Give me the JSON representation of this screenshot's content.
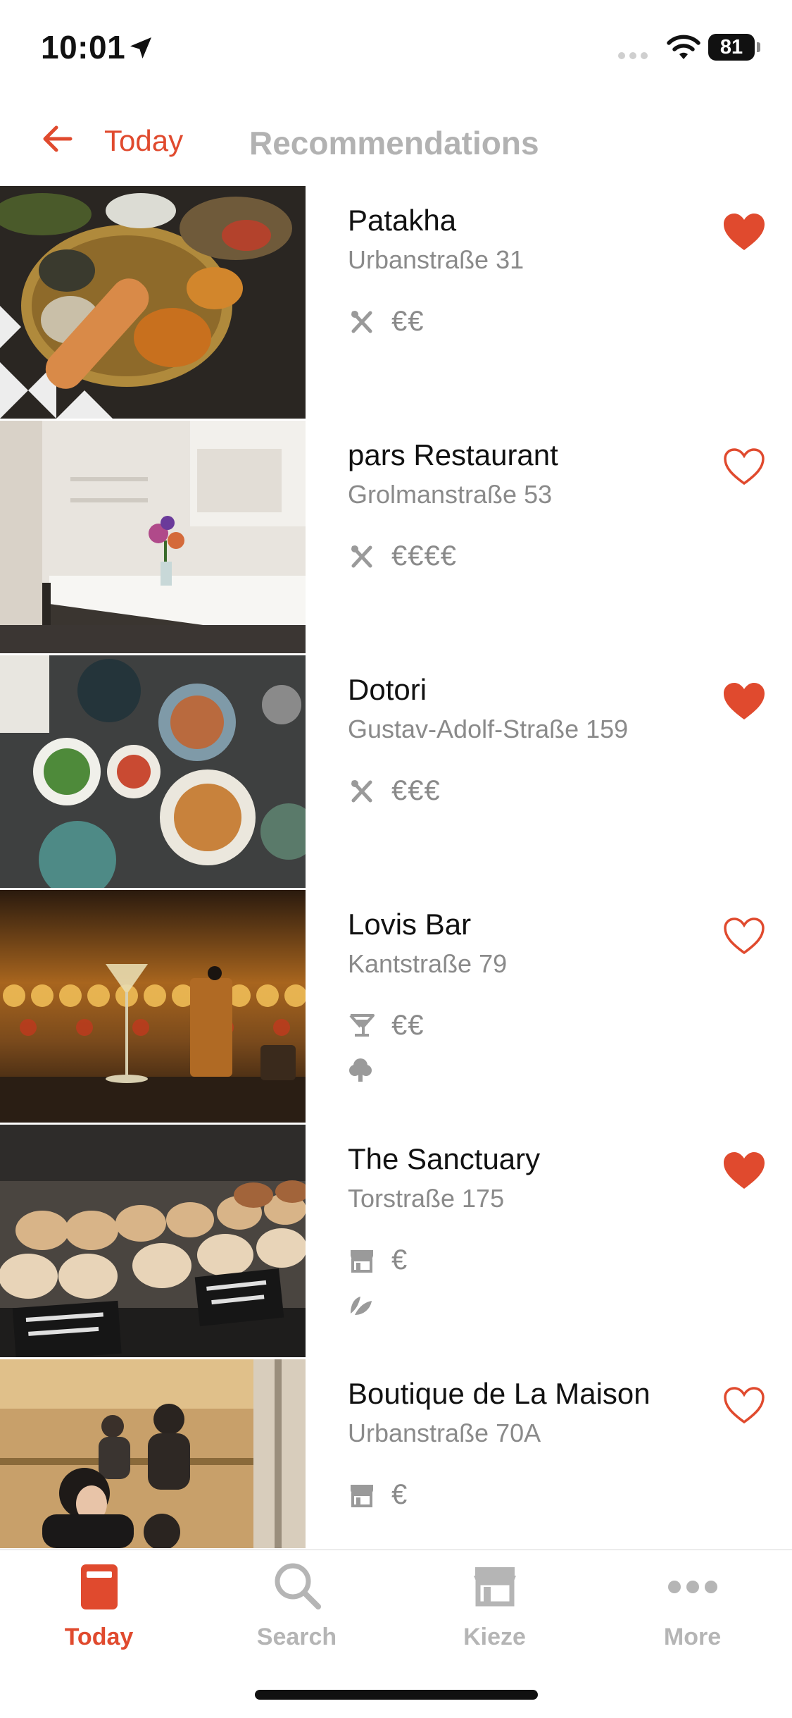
{
  "status_bar": {
    "time": "10:01",
    "battery": "81"
  },
  "nav": {
    "back_label": "Today",
    "title": "Recommendations"
  },
  "colors": {
    "accent": "#e04a2e",
    "muted": "#8a8a8a"
  },
  "places": [
    {
      "name": "Patakha",
      "address": "Urbanstraße 31",
      "category_icon": "cutlery-icon",
      "price": "€€",
      "extra_icon": null,
      "favorite": true
    },
    {
      "name": "pars Restaurant",
      "address": "Grolmanstraße 53",
      "category_icon": "cutlery-icon",
      "price": "€€€€",
      "extra_icon": null,
      "favorite": false
    },
    {
      "name": "Dotori",
      "address": "Gustav-Adolf-Straße 159",
      "category_icon": "cutlery-icon",
      "price": "€€€",
      "extra_icon": null,
      "favorite": true
    },
    {
      "name": "Lovis Bar",
      "address": "Kantstraße 79",
      "category_icon": "cocktail-icon",
      "price": "€€",
      "extra_icon": "tree-icon",
      "favorite": false
    },
    {
      "name": "The Sanctuary",
      "address": "Torstraße 175",
      "category_icon": "shop-icon",
      "price": "€",
      "extra_icon": "leaf-icon",
      "favorite": true
    },
    {
      "name": "Boutique de La Maison",
      "address": "Urbanstraße 70A",
      "category_icon": "shop-icon",
      "price": "€",
      "extra_icon": null,
      "favorite": false
    }
  ],
  "tabs": [
    {
      "label": "Today",
      "icon": "today-icon",
      "active": true
    },
    {
      "label": "Search",
      "icon": "search-icon",
      "active": false
    },
    {
      "label": "Kieze",
      "icon": "shop-icon",
      "active": false
    },
    {
      "label": "More",
      "icon": "more-icon",
      "active": false
    }
  ]
}
